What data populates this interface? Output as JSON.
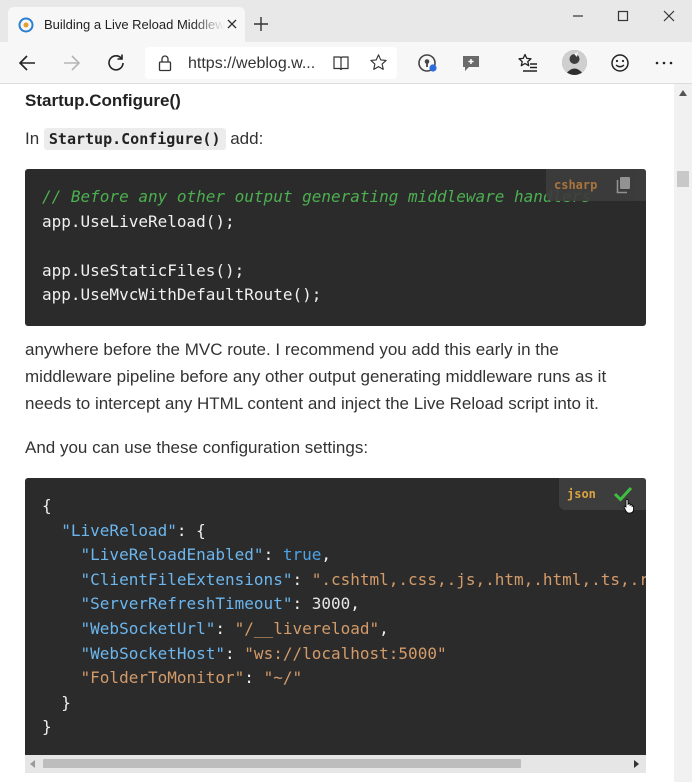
{
  "browser": {
    "tab_title": "Building a Live Reload Middleware",
    "url_display": "https://weblog.w...",
    "colors": {
      "tab_bar": "#e8e8e8",
      "toolbar": "#f7f7f7"
    }
  },
  "article": {
    "heading": "Startup.Configure()",
    "intro_prefix": "In ",
    "intro_code": "Startup.Configure()",
    "intro_suffix": " add:",
    "code1": {
      "language": "csharp",
      "comment": "// Before any other output generating middleware handlers",
      "line2": "app.UseLiveReload();",
      "line4": "app.UseStaticFiles();",
      "line5": "app.UseMvcWithDefaultRoute();"
    },
    "paragraph1": "anywhere before the MVC route. I recommend you add this early in the middleware pipeline before any other output generating middleware runs as it needs to intercept any HTML content and inject the Live Reload script into it.",
    "paragraph2": "And you can use these configuration settings:",
    "code2": {
      "language": "json",
      "open_brace": "{",
      "root_key": "\"LiveReload\"",
      "root_open": ": {",
      "entries": [
        {
          "key": "\"LiveReloadEnabled\"",
          "sep": ": ",
          "value": "true",
          "type": "bool",
          "tail": ","
        },
        {
          "key": "\"ClientFileExtensions\"",
          "sep": ": ",
          "value": "\".cshtml,.css,.js,.htm,.html,.ts,.ra",
          "type": "str",
          "tail": ""
        },
        {
          "key": "\"ServerRefreshTimeout\"",
          "sep": ": ",
          "value": "3000",
          "type": "num",
          "tail": ","
        },
        {
          "key": "\"WebSocketUrl\"",
          "sep": ": ",
          "value": "\"/__livereload\"",
          "type": "str",
          "tail": ","
        },
        {
          "key": "\"WebSocketHost\"",
          "sep": ": ",
          "value": "\"ws://localhost:5000\"",
          "type": "str",
          "tail": ""
        },
        {
          "key": "\"FolderToMonitor\"",
          "sep": ": ",
          "value": "\"~/\"",
          "type": "str",
          "tail": ""
        }
      ],
      "inner_close": "}",
      "outer_close": "}"
    }
  }
}
